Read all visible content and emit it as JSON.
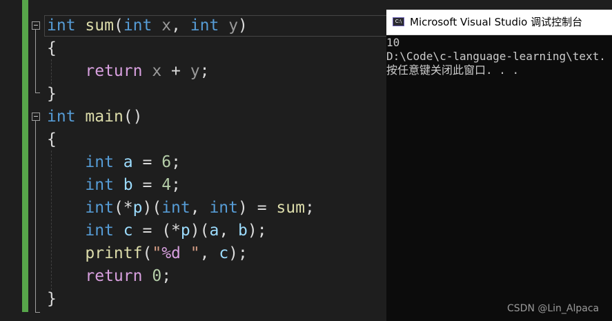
{
  "editor": {
    "lines": [
      {
        "tokens": [
          {
            "t": "int",
            "c": "kw"
          },
          {
            "t": " ",
            "c": ""
          },
          {
            "t": "sum",
            "c": "fn"
          },
          {
            "t": "(",
            "c": ""
          },
          {
            "t": "int",
            "c": "kw"
          },
          {
            "t": " ",
            "c": ""
          },
          {
            "t": "x",
            "c": "param"
          },
          {
            "t": ", ",
            "c": ""
          },
          {
            "t": "int",
            "c": "kw"
          },
          {
            "t": " ",
            "c": ""
          },
          {
            "t": "y",
            "c": "param"
          },
          {
            "t": ")",
            "c": ""
          }
        ]
      },
      {
        "tokens": [
          {
            "t": "{",
            "c": ""
          }
        ]
      },
      {
        "tokens": [
          {
            "t": "    ",
            "c": ""
          },
          {
            "t": "return",
            "c": "ctl"
          },
          {
            "t": " ",
            "c": ""
          },
          {
            "t": "x",
            "c": "param"
          },
          {
            "t": " + ",
            "c": ""
          },
          {
            "t": "y",
            "c": "param"
          },
          {
            "t": ";",
            "c": ""
          }
        ]
      },
      {
        "tokens": [
          {
            "t": "}",
            "c": ""
          }
        ]
      },
      {
        "tokens": [
          {
            "t": "int",
            "c": "kw"
          },
          {
            "t": " ",
            "c": ""
          },
          {
            "t": "main",
            "c": "fn"
          },
          {
            "t": "()",
            "c": ""
          }
        ]
      },
      {
        "tokens": [
          {
            "t": "{",
            "c": ""
          }
        ]
      },
      {
        "tokens": [
          {
            "t": "    ",
            "c": ""
          },
          {
            "t": "int",
            "c": "kw"
          },
          {
            "t": " ",
            "c": ""
          },
          {
            "t": "a",
            "c": "var"
          },
          {
            "t": " = ",
            "c": ""
          },
          {
            "t": "6",
            "c": "num"
          },
          {
            "t": ";",
            "c": ""
          }
        ]
      },
      {
        "tokens": [
          {
            "t": "    ",
            "c": ""
          },
          {
            "t": "int",
            "c": "kw"
          },
          {
            "t": " ",
            "c": ""
          },
          {
            "t": "b",
            "c": "var"
          },
          {
            "t": " = ",
            "c": ""
          },
          {
            "t": "4",
            "c": "num"
          },
          {
            "t": ";",
            "c": ""
          }
        ]
      },
      {
        "tokens": [
          {
            "t": "    ",
            "c": ""
          },
          {
            "t": "int",
            "c": "kw"
          },
          {
            "t": "(*",
            "c": ""
          },
          {
            "t": "p",
            "c": "var"
          },
          {
            "t": ")(",
            "c": ""
          },
          {
            "t": "int",
            "c": "kw"
          },
          {
            "t": ", ",
            "c": ""
          },
          {
            "t": "int",
            "c": "kw"
          },
          {
            "t": ") = ",
            "c": ""
          },
          {
            "t": "sum",
            "c": "fn"
          },
          {
            "t": ";",
            "c": ""
          }
        ]
      },
      {
        "tokens": [
          {
            "t": "    ",
            "c": ""
          },
          {
            "t": "int",
            "c": "kw"
          },
          {
            "t": " ",
            "c": ""
          },
          {
            "t": "c",
            "c": "var"
          },
          {
            "t": " = (*",
            "c": ""
          },
          {
            "t": "p",
            "c": "var"
          },
          {
            "t": ")(",
            "c": ""
          },
          {
            "t": "a",
            "c": "var"
          },
          {
            "t": ", ",
            "c": ""
          },
          {
            "t": "b",
            "c": "var"
          },
          {
            "t": ");",
            "c": ""
          }
        ]
      },
      {
        "tokens": [
          {
            "t": "    ",
            "c": ""
          },
          {
            "t": "printf",
            "c": "fn"
          },
          {
            "t": "(",
            "c": ""
          },
          {
            "t": "\"",
            "c": "str"
          },
          {
            "t": "%d",
            "c": "fmt"
          },
          {
            "t": " \"",
            "c": "str"
          },
          {
            "t": ", ",
            "c": ""
          },
          {
            "t": "c",
            "c": "var"
          },
          {
            "t": ");",
            "c": ""
          }
        ]
      },
      {
        "tokens": [
          {
            "t": "    ",
            "c": ""
          },
          {
            "t": "return",
            "c": "ctl"
          },
          {
            "t": " ",
            "c": ""
          },
          {
            "t": "0",
            "c": "num"
          },
          {
            "t": ";",
            "c": ""
          }
        ]
      },
      {
        "tokens": [
          {
            "t": "}",
            "c": ""
          }
        ]
      }
    ]
  },
  "console": {
    "icon_label": "C:\\",
    "title": "Microsoft Visual Studio 调试控制台",
    "lines": [
      "10",
      "D:\\Code\\c-language-learning\\text.",
      "按任意键关闭此窗口. . ."
    ]
  },
  "watermark": "CSDN @Lin_Alpaca",
  "colors": {
    "keyword": "#569cd6",
    "control": "#d8a0df",
    "function": "#dcdcaa",
    "parameter": "#9a9a9a",
    "variable": "#9cdcfe",
    "number": "#b5cea8",
    "string": "#d69d85",
    "change_bar": "#57a64a",
    "editor_bg": "#1e1e1e",
    "console_bg": "#0c0c0c"
  }
}
